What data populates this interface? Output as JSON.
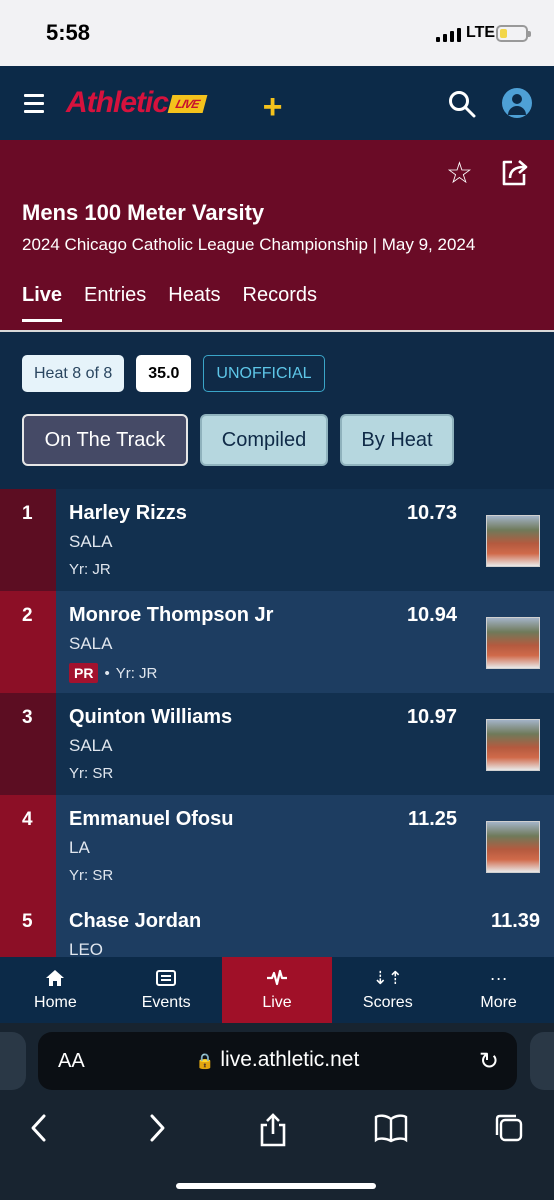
{
  "status_bar": {
    "time": "5:58",
    "network": "LTE"
  },
  "app": {
    "logo_text": "Athletic",
    "logo_badge": "LIVE",
    "plus": "+"
  },
  "event": {
    "title": "Mens 100 Meter Varsity",
    "subtitle": "2024 Chicago Catholic League Championship | May 9, 2024",
    "tabs": [
      {
        "label": "Live"
      },
      {
        "label": "Entries"
      },
      {
        "label": "Heats"
      },
      {
        "label": "Records"
      }
    ]
  },
  "heat_info": {
    "heat": "Heat 8 of 8",
    "wind": "35.0",
    "status": "UNOFFICIAL"
  },
  "view_toggle": [
    {
      "label": "On The Track"
    },
    {
      "label": "Compiled"
    },
    {
      "label": "By Heat"
    }
  ],
  "results": [
    {
      "place": "1",
      "name": "Harley Rizzs",
      "team": "SALA",
      "year": "Yr: JR",
      "mark": "10.73",
      "pr": ""
    },
    {
      "place": "2",
      "name": "Monroe Thompson Jr",
      "team": "SALA",
      "year": "Yr: JR",
      "mark": "10.94",
      "pr": "PR"
    },
    {
      "place": "3",
      "name": "Quinton Williams",
      "team": "SALA",
      "year": "Yr: SR",
      "mark": "10.97",
      "pr": ""
    },
    {
      "place": "4",
      "name": "Emmanuel Ofosu",
      "team": "LA",
      "year": "Yr: SR",
      "mark": "11.25",
      "pr": ""
    },
    {
      "place": "5",
      "name": "Chase Jordan",
      "team": "LEO",
      "year": "",
      "mark": "11.39",
      "pr": ""
    }
  ],
  "bottom_nav": [
    {
      "label": "Home",
      "icon": "home-icon"
    },
    {
      "label": "Events",
      "icon": "list-icon"
    },
    {
      "label": "Live",
      "icon": "pulse-icon"
    },
    {
      "label": "Scores",
      "icon": "sort-icon"
    },
    {
      "label": "More",
      "icon": "ellipsis-icon"
    }
  ],
  "browser": {
    "aa": "AA",
    "url": "live.athletic.net"
  },
  "colors": {
    "navy": "#0f2a47",
    "maroon": "#6a0b26",
    "red": "#a01028",
    "gold": "#f4c21c"
  }
}
